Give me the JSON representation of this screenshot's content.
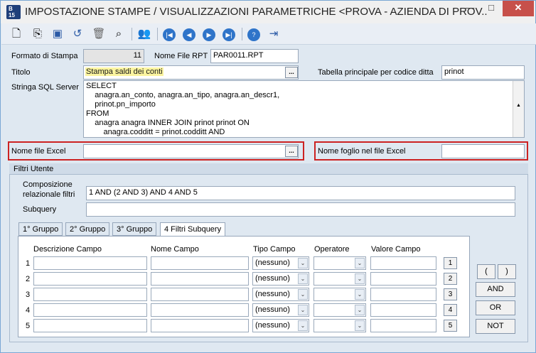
{
  "window": {
    "title": "IMPOSTAZIONE STAMPE / VISUALIZZAZIONI PARAMETRICHE <PROVA - AZIENDA DI PROV...",
    "app_badge": "B\n15",
    "minimize": "—",
    "maximize": "□",
    "close": "✕"
  },
  "toolbar": {
    "icons": [
      "new-icon",
      "copy-icon",
      "save-icon",
      "undo-icon",
      "delete-icon",
      "search-icon",
      "users-icon",
      "first-icon",
      "prev-icon",
      "next-icon",
      "last-icon",
      "help-icon",
      "exit-icon"
    ]
  },
  "form": {
    "formato_label": "Formato di Stampa",
    "formato_value": "11",
    "nome_rpt_label": "Nome File RPT",
    "nome_rpt_value": "PAR0011.RPT",
    "titolo_label": "Titolo",
    "titolo_value": "Stampa saldi dei conti",
    "tabella_label": "Tabella principale per codice ditta",
    "tabella_value": "prinot",
    "sql_label": "Stringa SQL Server",
    "sql_lines": [
      "SELECT",
      "    anagra.an_conto, anagra.an_tipo, anagra.an_descr1,",
      "    prinot.pn_importo",
      "FROM",
      "    anagra anagra INNER JOIN prinot prinot ON",
      "        anagra.codditt = prinot.codditt AND"
    ],
    "excel_label": "Nome file Excel",
    "excel_value": "",
    "foglio_label": "Nome foglio nel file Excel",
    "foglio_value": "",
    "ellipsis": "..."
  },
  "filters": {
    "title": "Filtri Utente",
    "composizione_label_1": "Composizione",
    "composizione_label_2": "relazionale filtri",
    "composizione_value": "1 AND (2 AND 3) AND 4 AND 5",
    "subquery_label": "Subquery",
    "subquery_value": "",
    "tabs": [
      "1° Gruppo",
      "2° Gruppo",
      "3° Gruppo",
      "4 Filtri Subquery"
    ],
    "columns": [
      "Descrizione Campo",
      "Nome Campo",
      "Tipo Campo",
      "Operatore",
      "Valore Campo"
    ],
    "rows": [
      {
        "num": "1",
        "tipo": "(nessuno)",
        "btn": "1"
      },
      {
        "num": "2",
        "tipo": "(nessuno)",
        "btn": "2"
      },
      {
        "num": "3",
        "tipo": "(nessuno)",
        "btn": "3"
      },
      {
        "num": "4",
        "tipo": "(nessuno)",
        "btn": "4"
      },
      {
        "num": "5",
        "tipo": "(nessuno)",
        "btn": "5"
      }
    ],
    "paren_open": "(",
    "paren_close": ")",
    "and_label": "AND",
    "or_label": "OR",
    "not_label": "NOT"
  }
}
